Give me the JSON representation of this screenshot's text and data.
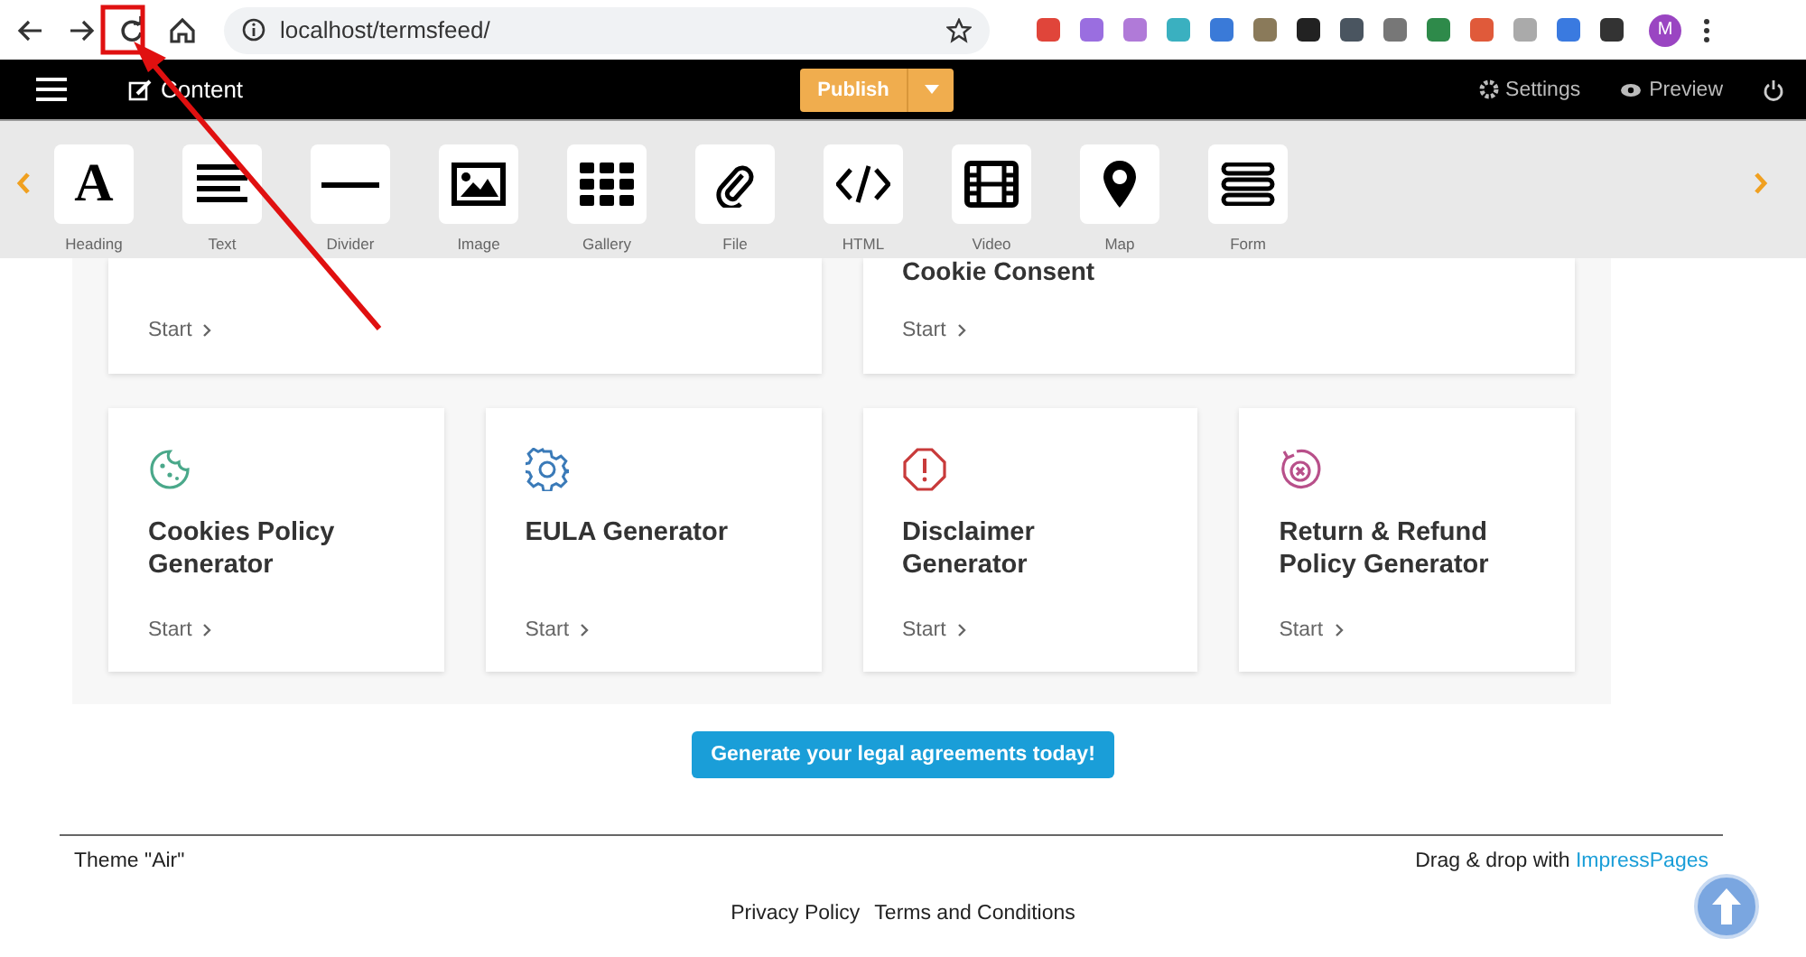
{
  "browser": {
    "url": "localhost/termsfeed/",
    "profile_initial": "M",
    "extensions": [
      {
        "color": "#e0453a"
      },
      {
        "color": "#9a6ee0"
      },
      {
        "color": "#b07ad8"
      },
      {
        "color": "#3ab0c0"
      },
      {
        "color": "#3a7ad8"
      },
      {
        "color": "#8a7a5a"
      },
      {
        "color": "#222222"
      },
      {
        "color": "#4a5560"
      },
      {
        "color": "#777777"
      },
      {
        "color": "#2e8a4a"
      },
      {
        "color": "#e05a3a"
      },
      {
        "color": "#aaaaaa"
      },
      {
        "color": "#3a7ae0"
      },
      {
        "color": "#333333"
      }
    ]
  },
  "admin_bar": {
    "section": "Content",
    "publish": "Publish",
    "settings": "Settings",
    "preview": "Preview"
  },
  "widgets": [
    {
      "kind": "heading",
      "glyph": "A",
      "label": "Heading"
    },
    {
      "kind": "text",
      "label": "Text"
    },
    {
      "kind": "divider",
      "label": "Divider"
    },
    {
      "kind": "image",
      "label": "Image"
    },
    {
      "kind": "gallery",
      "label": "Gallery"
    },
    {
      "kind": "file",
      "label": "File"
    },
    {
      "kind": "html",
      "label": "HTML"
    },
    {
      "kind": "video",
      "label": "Video"
    },
    {
      "kind": "map",
      "label": "Map"
    },
    {
      "kind": "form",
      "label": "Form"
    }
  ],
  "top_cards": [
    {
      "link": "Start"
    },
    {
      "title": "Cookie Consent",
      "link": "Start"
    }
  ],
  "cards": [
    {
      "kind": "cookie",
      "color": "#4aa88a",
      "title": "Cookies Policy Generator",
      "link": "Start"
    },
    {
      "kind": "gear",
      "color": "#3a7ab8",
      "title": "EULA Generator",
      "link": "Start"
    },
    {
      "kind": "alert",
      "color": "#c83a3a",
      "title": "Disclaimer Generator",
      "link": "Start"
    },
    {
      "kind": "refund",
      "color": "#b8508a",
      "title": "Return & Refund Policy Generator",
      "link": "Start"
    }
  ],
  "cta": "Generate your legal agreements today!",
  "footer": {
    "theme": "Theme \"Air\"",
    "credit": "Drag & drop with",
    "credit_link": "ImpressPages",
    "links": [
      "Privacy Policy",
      "Terms and Conditions"
    ]
  }
}
